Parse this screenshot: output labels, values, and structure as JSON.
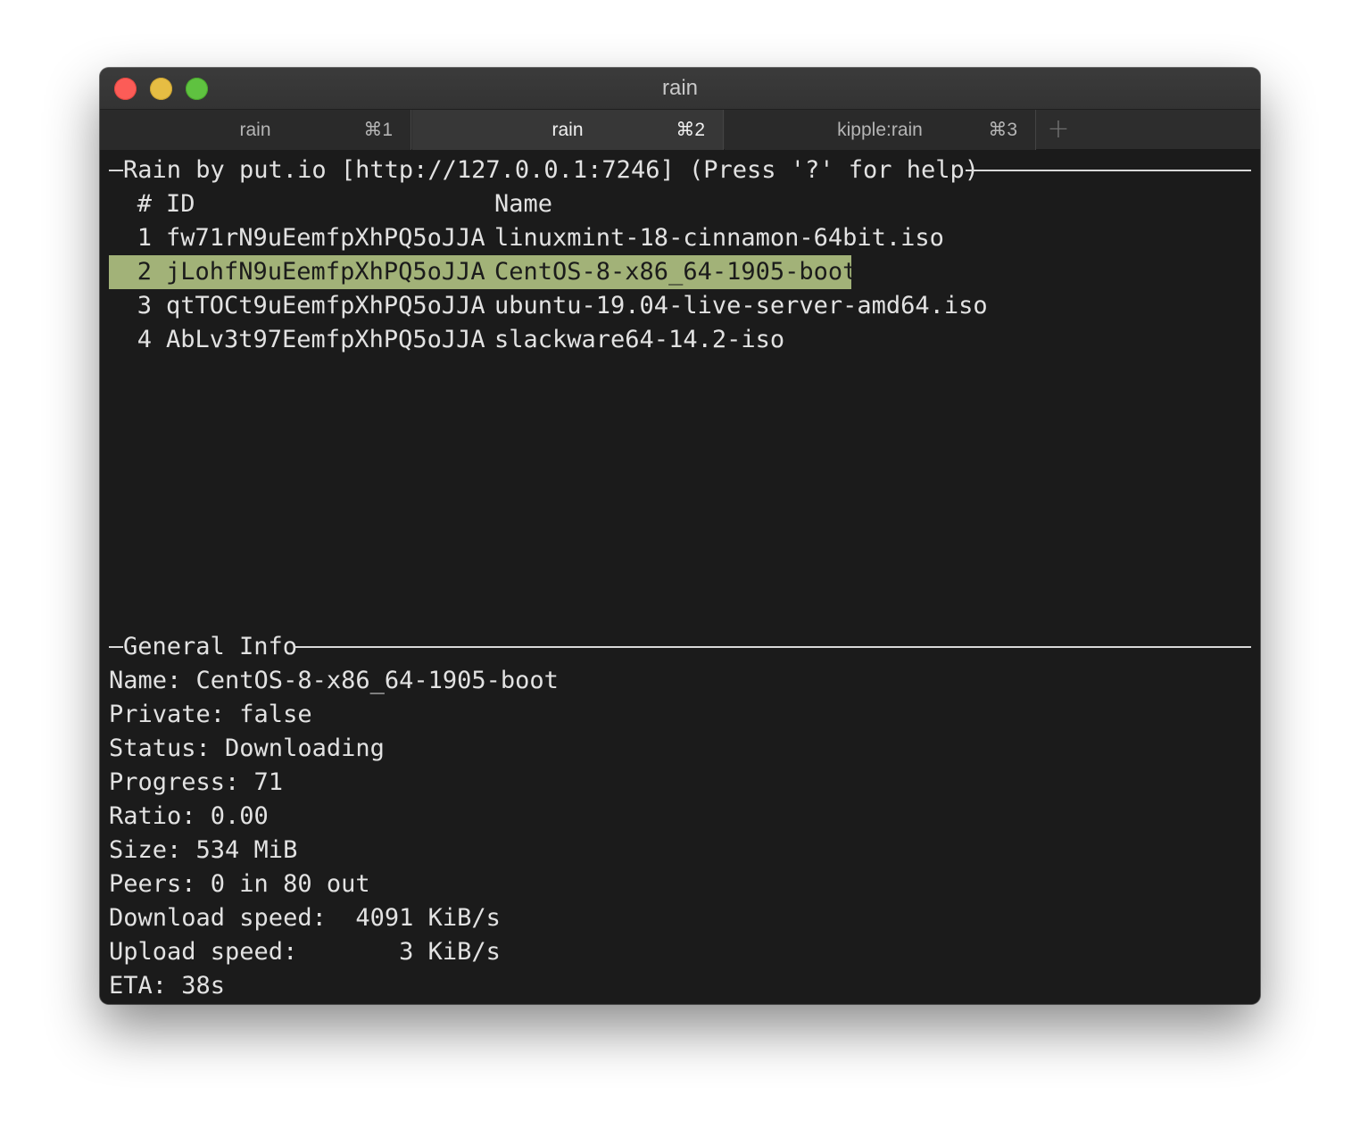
{
  "window": {
    "title": "rain"
  },
  "tabs": [
    {
      "label": "rain",
      "shortcut": "⌘1",
      "active": false
    },
    {
      "label": "rain",
      "shortcut": "⌘2",
      "active": true
    },
    {
      "label": "kipple:rain",
      "shortcut": "⌘3",
      "active": false
    }
  ],
  "new_tab_glyph": "+",
  "torrent_panel": {
    "title": "Rain by put.io [http://127.0.0.1:7246] (Press '?' for help)",
    "header": {
      "num": "#",
      "id": "ID",
      "name": "Name"
    },
    "rows": [
      {
        "num": "1",
        "id": "fw71rN9uEemfpXhPQ5oJJA",
        "name": "linuxmint-18-cinnamon-64bit.iso",
        "selected": false
      },
      {
        "num": "2",
        "id": "jLohfN9uEemfpXhPQ5oJJA",
        "name": "CentOS-8-x86_64-1905-boot",
        "selected": true
      },
      {
        "num": "3",
        "id": "qtTOCt9uEemfpXhPQ5oJJA",
        "name": "ubuntu-19.04-live-server-amd64.iso",
        "selected": false
      },
      {
        "num": "4",
        "id": "AbLv3t97EemfpXhPQ5oJJA",
        "name": "slackware64-14.2-iso",
        "selected": false
      }
    ]
  },
  "info_panel": {
    "title": "General Info",
    "lines": [
      "Name: CentOS-8-x86_64-1905-boot",
      "Private: false",
      "Status: Downloading",
      "Progress: 71",
      "Ratio: 0.00",
      "Size: 534 MiB",
      "Peers: 0 in 80 out",
      "Download speed:  4091 KiB/s",
      "Upload speed:       3 KiB/s",
      "ETA: 38s"
    ]
  },
  "colors": {
    "terminal_bg": "#1b1b1b",
    "terminal_fg": "#e2e2e2",
    "selection_bg": "#a2b278",
    "close": "#fc5c57",
    "minimize": "#e6bd43",
    "maximize": "#5fc240"
  }
}
